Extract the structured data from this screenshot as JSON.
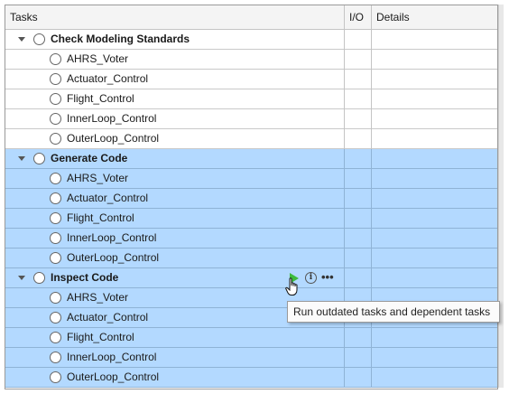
{
  "headers": {
    "tasks": "Tasks",
    "io": "I/O",
    "details": "Details"
  },
  "colors": {
    "selected": "#b3d9ff",
    "run": "#3dbb3d"
  },
  "groups": [
    {
      "label": "Check Modeling Standards",
      "selected": false,
      "children": [
        "AHRS_Voter",
        "Actuator_Control",
        "Flight_Control",
        "InnerLoop_Control",
        "OuterLoop_Control"
      ]
    },
    {
      "label": "Generate Code",
      "selected": true,
      "children": [
        "AHRS_Voter",
        "Actuator_Control",
        "Flight_Control",
        "InnerLoop_Control",
        "OuterLoop_Control"
      ]
    },
    {
      "label": "Inspect Code",
      "selected": true,
      "hovered": true,
      "children": [
        "AHRS_Voter",
        "Actuator_Control",
        "Flight_Control",
        "InnerLoop_Control",
        "OuterLoop_Control"
      ]
    }
  ],
  "hover_icons": [
    "play-icon",
    "info-icon",
    "more-icon"
  ],
  "more_glyph": "•••",
  "info_glyph": "i",
  "tooltip": "Run outdated tasks and dependent tasks"
}
